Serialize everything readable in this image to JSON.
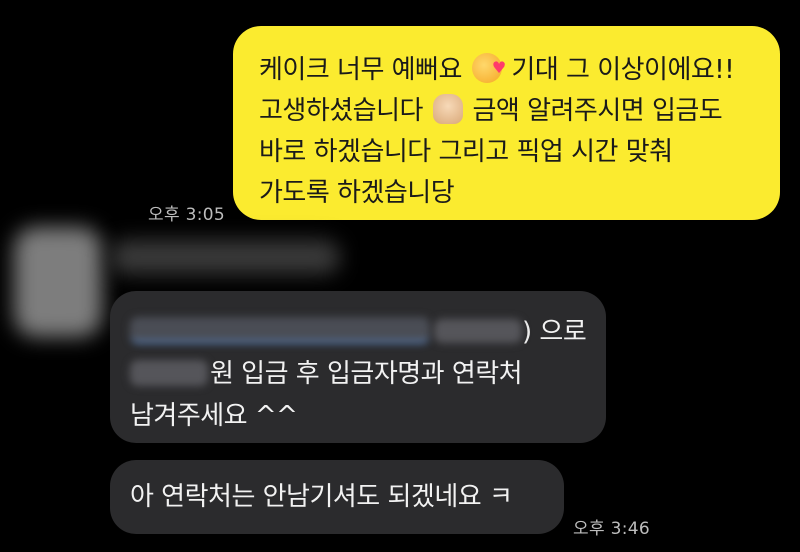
{
  "outgoing": {
    "line1_a": "케이크 너무 예뻐요",
    "line1_emoji": "smiling-face-with-hearts",
    "line1_b": "기대 그 이상이에요!!",
    "line2_a": "고생하셨습니다",
    "line2_emoji": "thumbs-up",
    "line2_b": "금액 알려주시면 입금도",
    "line3": "바로 하겠습니다 그리고 픽업 시간 맞춰",
    "line4": "가도록 하겠습니당",
    "timestamp": "오후 3:05",
    "color": "#fbeb2f"
  },
  "incoming": {
    "message1": {
      "line1_suffix": ") 으로",
      "line2_suffix": "원 입금 후 입금자명과 연락처",
      "line3": "남겨주세요 ^^"
    },
    "message2": {
      "text": "아 연락처는 안남기셔도 되겠네요 ㅋ",
      "timestamp": "오후 3:46"
    },
    "color": "#2b2b2d"
  },
  "background": "#000000"
}
